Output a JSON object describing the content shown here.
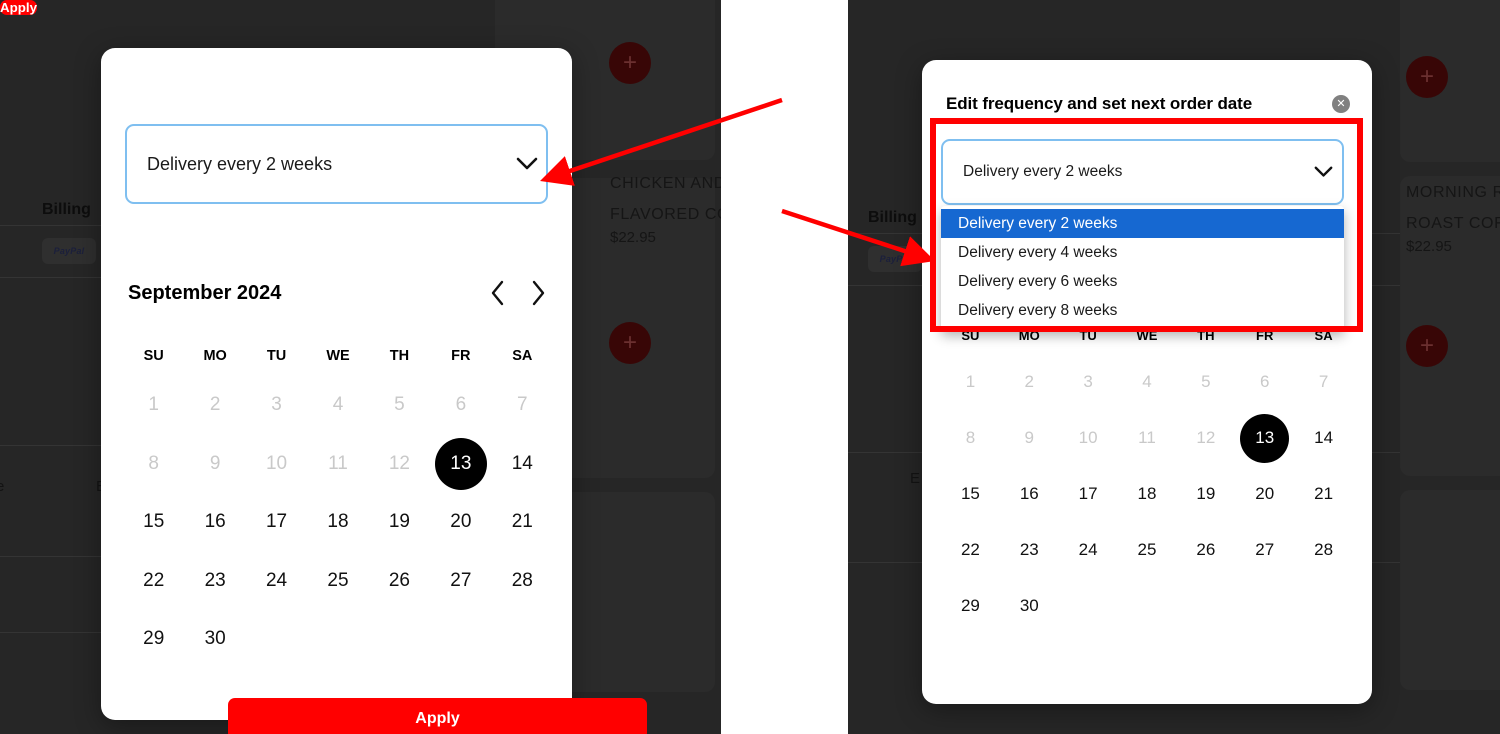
{
  "modal": {
    "title": "Edit frequency and set next order date",
    "close_icon": "close-circle-icon",
    "frequency_select": {
      "value": "Delivery every 2 weeks",
      "chevron_icon": "chevron-down-icon",
      "options": [
        "Delivery every 2 weeks",
        "Delivery every 4 weeks",
        "Delivery every 6 weeks",
        "Delivery every 8 weeks"
      ],
      "selected_index": 0
    },
    "calendar": {
      "month_label": "September 2024",
      "prev_icon": "chevron-left-icon",
      "next_icon": "chevron-right-icon",
      "weekdays": [
        "SU",
        "MO",
        "TU",
        "WE",
        "TH",
        "FR",
        "SA"
      ],
      "selected_day": "13",
      "days": [
        {
          "n": "1",
          "state": "disabled"
        },
        {
          "n": "2",
          "state": "disabled"
        },
        {
          "n": "3",
          "state": "disabled"
        },
        {
          "n": "4",
          "state": "disabled"
        },
        {
          "n": "5",
          "state": "disabled"
        },
        {
          "n": "6",
          "state": "disabled"
        },
        {
          "n": "7",
          "state": "disabled"
        },
        {
          "n": "8",
          "state": "disabled"
        },
        {
          "n": "9",
          "state": "disabled"
        },
        {
          "n": "10",
          "state": "disabled"
        },
        {
          "n": "11",
          "state": "disabled"
        },
        {
          "n": "12",
          "state": "disabled"
        },
        {
          "n": "13",
          "state": "selected"
        },
        {
          "n": "14",
          "state": "enabled"
        },
        {
          "n": "15",
          "state": "enabled"
        },
        {
          "n": "16",
          "state": "enabled"
        },
        {
          "n": "17",
          "state": "enabled"
        },
        {
          "n": "18",
          "state": "enabled"
        },
        {
          "n": "19",
          "state": "enabled"
        },
        {
          "n": "20",
          "state": "enabled"
        },
        {
          "n": "21",
          "state": "enabled"
        },
        {
          "n": "22",
          "state": "enabled"
        },
        {
          "n": "23",
          "state": "enabled"
        },
        {
          "n": "24",
          "state": "enabled"
        },
        {
          "n": "25",
          "state": "enabled"
        },
        {
          "n": "26",
          "state": "enabled"
        },
        {
          "n": "27",
          "state": "enabled"
        },
        {
          "n": "28",
          "state": "enabled"
        },
        {
          "n": "29",
          "state": "enabled"
        },
        {
          "n": "30",
          "state": "enabled"
        }
      ]
    },
    "apply_label": "Apply"
  },
  "background_left": {
    "billing_label": "Billing",
    "paypal_label": "PayPal",
    "dots": "•••",
    "product": {
      "title_line1": "CHICKEN AND",
      "title_line2": "FLAVORED CO",
      "price": "$22.95"
    },
    "add_icon": "plus-icon",
    "edge_fragment_left": "e",
    "edge_fragment_right": "E"
  },
  "background_right": {
    "billing_label": "Billing",
    "paypal_label": "PayPal",
    "product": {
      "title_line1": "MORNING R",
      "title_line2": "ROAST COF",
      "price": "$22.95"
    },
    "add_icon": "plus-icon",
    "edge_fragment": "E"
  },
  "annotations": {
    "highlight_color": "#FF0000",
    "arrow1": {
      "name": "arrow-to-frequency-select"
    },
    "arrow2": {
      "name": "arrow-to-dropdown-options"
    },
    "highlight_box": {
      "name": "dropdown-highlight-box"
    }
  }
}
